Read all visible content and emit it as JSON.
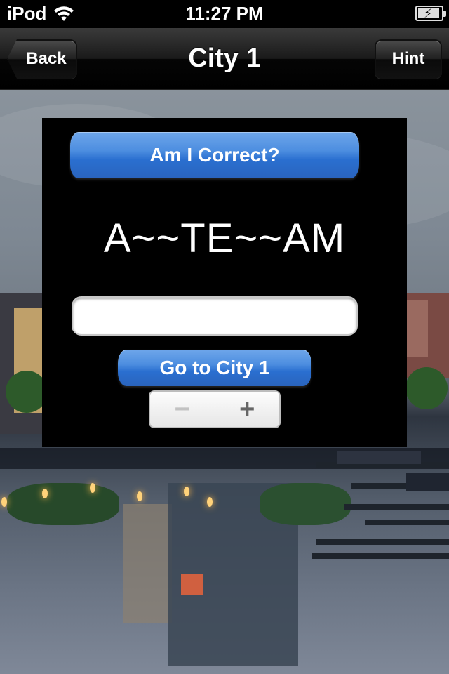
{
  "status_bar": {
    "carrier": "iPod",
    "time": "11:27 PM",
    "wifi_icon": "wifi-icon",
    "battery_icon": "battery-charging-icon"
  },
  "nav_bar": {
    "title": "City 1",
    "back_label": "Back",
    "hint_label": "Hint"
  },
  "panel": {
    "check_button_label": "Am I Correct?",
    "puzzle_word": "A~~TE~~AM",
    "answer_input": {
      "value": "",
      "placeholder": ""
    },
    "go_button_label": "Go to City 1",
    "stepper": {
      "minus_label": "−",
      "plus_label": "+"
    }
  },
  "colors": {
    "button_blue": "#2a6fd0",
    "panel_bg": "#000000",
    "nav_bg": "#1a1a1a"
  }
}
